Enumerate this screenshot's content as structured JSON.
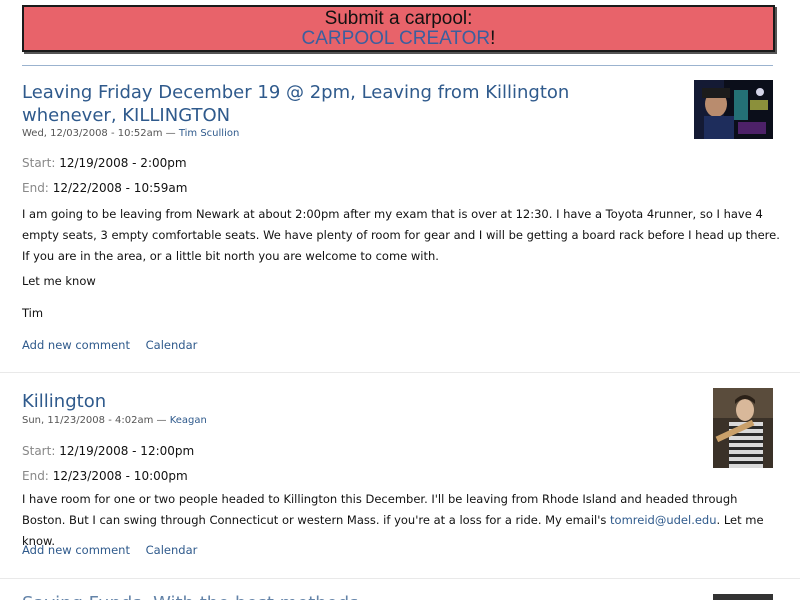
{
  "banner": {
    "line1": "Submit a carpool:",
    "link": "CARPOOL CREATOR",
    "suffix": "!"
  },
  "posts": [
    {
      "title": "Leaving Friday December 19 @ 2pm, Leaving from Killington whenever, KILLINGTON",
      "date": "Wed, 12/03/2008 - 10:52am",
      "separator": "—",
      "author": "Tim Scullion",
      "start_label": "Start:",
      "start": "12/19/2008 - 2:00pm",
      "end_label": "End:",
      "end": "12/22/2008 - 10:59am",
      "body": "I am going to be leaving from Newark at about 2:00pm after my exam that is over at 12:30. I have a Toyota 4runner, so I have 4 empty seats, 3 empty comfortable seats. We have plenty of room for gear and I will be getting a board rack before I head up there. If you are in the area, or a little bit north you are welcome to come with.",
      "body2": "Let me know",
      "body3": "Tim",
      "links": [
        "Add new comment",
        "Calendar"
      ]
    },
    {
      "title": "Killington",
      "date": "Sun, 11/23/2008 - 4:02am",
      "separator": "—",
      "author": "Keagan",
      "start_label": "Start:",
      "start": "12/19/2008 - 12:00pm",
      "end_label": "End:",
      "end": "12/23/2008 - 10:00pm",
      "body_pre": "I have room for one or two people headed to Killington this December. I'll be leaving from Rhode Island and headed through Boston. But I can swing through Connecticut or western Mass. if you're at a loss for a ride. My email's ",
      "email": "tomreid@udel.edu",
      "body_post": ". Let me know.",
      "links": [
        "Add new comment",
        "Calendar"
      ]
    },
    {
      "title": "Saving Funds, With the best methods"
    }
  ]
}
